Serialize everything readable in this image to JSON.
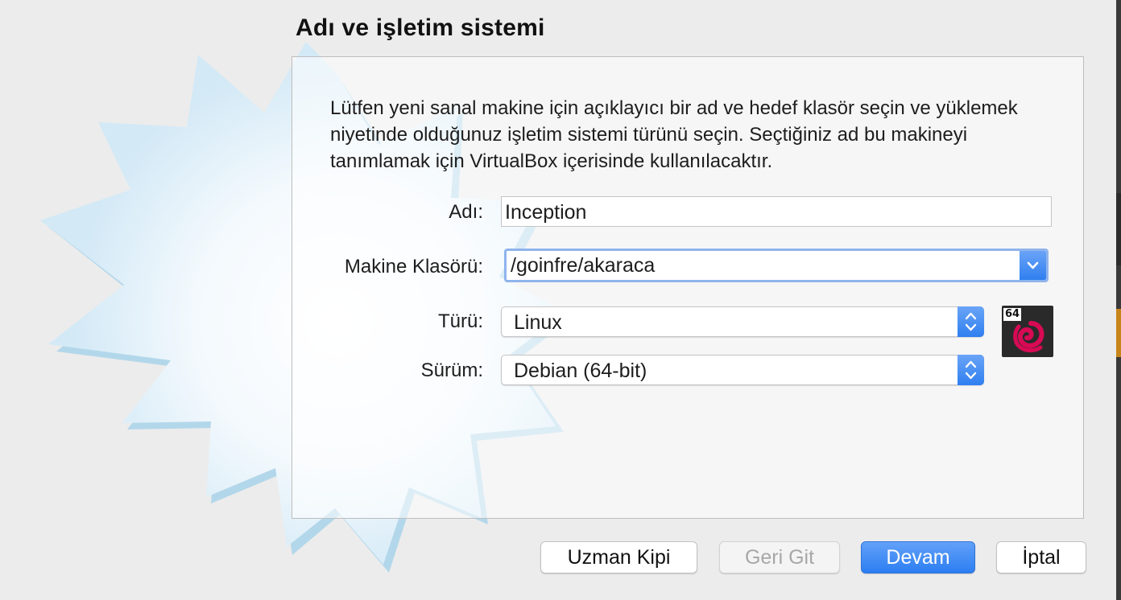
{
  "page": {
    "title": "Adı ve işletim sistemi",
    "description": "Lütfen yeni sanal makine için açıklayıcı bir ad ve hedef klasör seçin ve yüklemek niyetinde olduğunuz işletim sistemi türünü seçin. Seçtiğiniz ad bu makineyi tanımlamak için VirtualBox içerisinde kullanılacaktır."
  },
  "form": {
    "name_label": "Adı:",
    "name_value": "Inception",
    "folder_label": "Makine Klasörü:",
    "folder_value": "/goinfre/akaraca",
    "type_label": "Türü:",
    "type_value": "Linux",
    "version_label": "Sürüm:",
    "version_value": "Debian (64-bit)",
    "os_icon": "debian-swirl-icon",
    "os_badge": "64"
  },
  "buttons": {
    "expert": "Uzman Kipi",
    "back": "Geri Git",
    "next": "Devam",
    "cancel": "İptal"
  },
  "colors": {
    "accent": "#2f7ff0",
    "debian_red": "#d70a53"
  }
}
